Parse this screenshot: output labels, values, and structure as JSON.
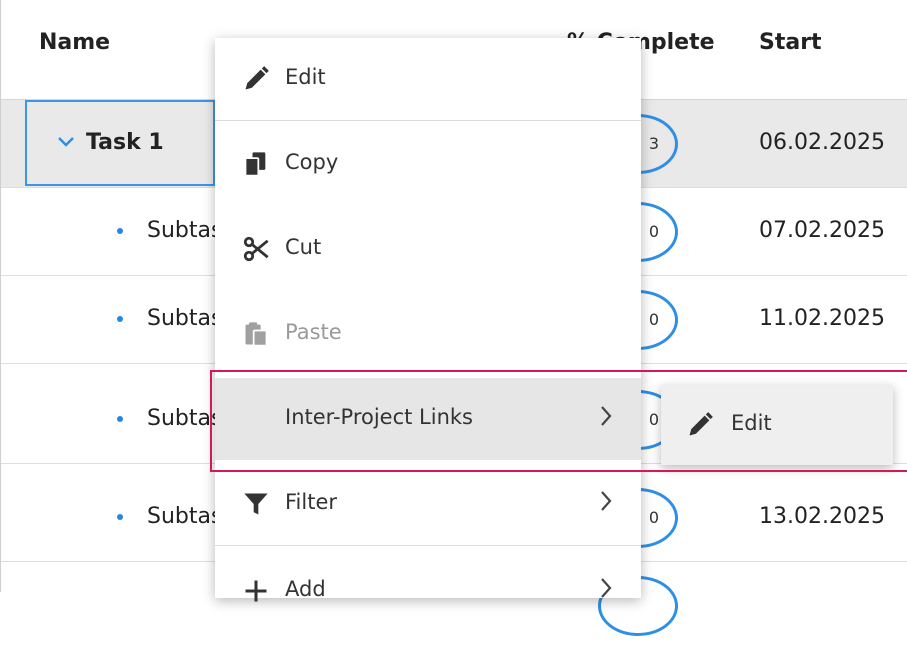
{
  "columns": {
    "name": "Name",
    "complete": "% Complete",
    "start": "Start"
  },
  "rows": [
    {
      "name": "Task 1",
      "complete": "3",
      "start": "06.02.2025"
    },
    {
      "name": "Subtask",
      "complete": "0",
      "start": "07.02.2025"
    },
    {
      "name": "Subtask",
      "complete": "0",
      "start": "11.02.2025"
    },
    {
      "name": "Subtask",
      "complete": "0",
      "start": ""
    },
    {
      "name": "Subtask",
      "complete": "0",
      "start": "13.02.2025"
    }
  ],
  "context_menu": {
    "items": [
      {
        "label": "Edit",
        "icon": "pencil-icon",
        "enabled": true
      },
      {
        "label": "Copy",
        "icon": "copy-icon",
        "enabled": true
      },
      {
        "label": "Cut",
        "icon": "scissors-icon",
        "enabled": true
      },
      {
        "label": "Paste",
        "icon": "paste-icon",
        "enabled": false
      },
      {
        "label": "Inter-Project Links",
        "icon": "",
        "enabled": true,
        "submenu": true
      },
      {
        "label": "Filter",
        "icon": "filter-icon",
        "enabled": true,
        "submenu": true
      },
      {
        "label": "Add",
        "icon": "plus-icon",
        "enabled": true,
        "submenu": true
      }
    ]
  },
  "submenu": {
    "items": [
      {
        "label": "Edit",
        "icon": "pencil-icon"
      }
    ]
  },
  "colors": {
    "accent": "#2f8fe6",
    "highlight_box": "#d6185a",
    "selected_row": "#e9e9e9"
  }
}
